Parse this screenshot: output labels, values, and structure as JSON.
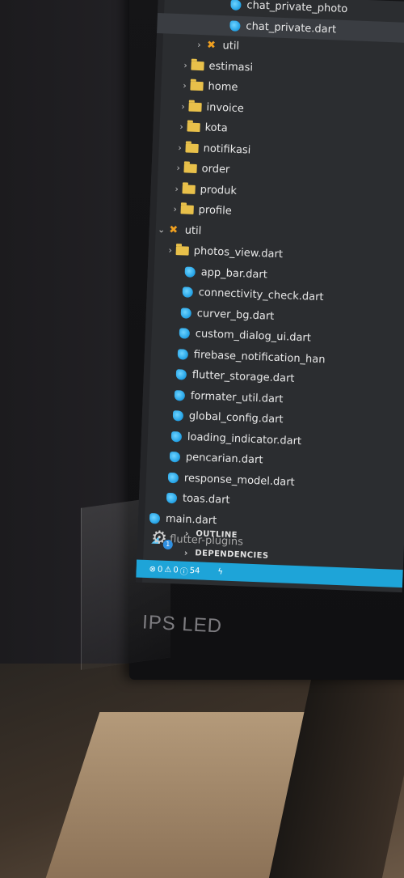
{
  "tree": [
    {
      "name": "chat_private_photo",
      "type": "dart",
      "indent": 150,
      "chevron": ""
    },
    {
      "name": "chat_private.dart",
      "type": "dart",
      "indent": 150,
      "chevron": "",
      "selected": true
    },
    {
      "name": "util",
      "type": "tool",
      "indent": 122,
      "chevron": "›"
    },
    {
      "name": "estimasi",
      "type": "folder",
      "indent": 108,
      "chevron": "›"
    },
    {
      "name": "home",
      "type": "folder",
      "indent": 108,
      "chevron": "›"
    },
    {
      "name": "invoice",
      "type": "folder",
      "indent": 108,
      "chevron": "›"
    },
    {
      "name": "kota",
      "type": "folder",
      "indent": 108,
      "chevron": "›"
    },
    {
      "name": "notifikasi",
      "type": "folder",
      "indent": 108,
      "chevron": "›"
    },
    {
      "name": "order",
      "type": "folder",
      "indent": 108,
      "chevron": "›"
    },
    {
      "name": "produk",
      "type": "folder",
      "indent": 108,
      "chevron": "›"
    },
    {
      "name": "profile",
      "type": "folder",
      "indent": 108,
      "chevron": "›"
    },
    {
      "name": "util",
      "type": "tool",
      "indent": 94,
      "chevron": "⌄"
    },
    {
      "name": "photos_view.dart",
      "type": "folder",
      "indent": 108,
      "chevron": "›"
    },
    {
      "name": "app_bar.dart",
      "type": "dart",
      "indent": 122,
      "chevron": ""
    },
    {
      "name": "connectivity_check.dart",
      "type": "dart",
      "indent": 122,
      "chevron": ""
    },
    {
      "name": "curver_bg.dart",
      "type": "dart",
      "indent": 122,
      "chevron": ""
    },
    {
      "name": "custom_dialog_ui.dart",
      "type": "dart",
      "indent": 122,
      "chevron": ""
    },
    {
      "name": "firebase_notification_han",
      "type": "dart",
      "indent": 122,
      "chevron": ""
    },
    {
      "name": "flutter_storage.dart",
      "type": "dart",
      "indent": 122,
      "chevron": ""
    },
    {
      "name": "formater_util.dart",
      "type": "dart",
      "indent": 122,
      "chevron": ""
    },
    {
      "name": "global_config.dart",
      "type": "dart",
      "indent": 122,
      "chevron": ""
    },
    {
      "name": "loading_indicator.dart",
      "type": "dart",
      "indent": 122,
      "chevron": ""
    },
    {
      "name": "pencarian.dart",
      "type": "dart",
      "indent": 122,
      "chevron": ""
    },
    {
      "name": "response_model.dart",
      "type": "dart",
      "indent": 122,
      "chevron": ""
    },
    {
      "name": "toas.dart",
      "type": "dart",
      "indent": 122,
      "chevron": ""
    },
    {
      "name": "main.dart",
      "type": "dart",
      "indent": 94,
      "chevron": ""
    },
    {
      "name": ".flutter-plugins",
      "type": "flutter",
      "indent": 80,
      "chevron": ""
    }
  ],
  "sections": {
    "outline": "OUTLINE",
    "dependencies": "DEPENDENCIES"
  },
  "gear_badge": "1",
  "status": {
    "errors": "0",
    "warnings": "0",
    "info": "54"
  },
  "brand": "IPS LED",
  "colors": {
    "statusbar": "#1ea4d8",
    "folder": "#e8c04a",
    "dart": "#2aa7e8",
    "sidebar_bg": "#2b2d30"
  }
}
